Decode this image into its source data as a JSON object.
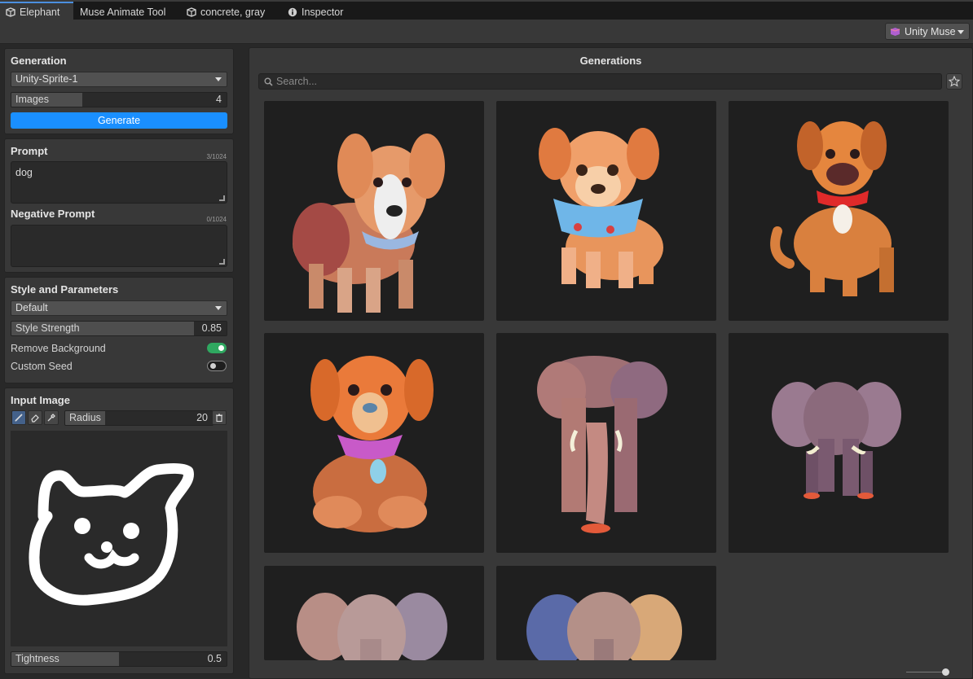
{
  "tabs": [
    {
      "label": "Elephant",
      "icon": "unity-logo-icon",
      "active": true
    },
    {
      "label": "Muse Animate Tool",
      "icon": "",
      "active": false
    },
    {
      "label": "concrete, gray",
      "icon": "unity-logo-icon",
      "active": false
    },
    {
      "label": "Inspector",
      "icon": "info-icon",
      "active": false
    }
  ],
  "toolbar": {
    "muse_label": "Unity Muse",
    "muse_icon": "muse-logo-icon"
  },
  "generation": {
    "title": "Generation",
    "model": "Unity-Sprite-1",
    "images_label": "Images",
    "images_value": "4",
    "images_fill": 0.33,
    "generate_label": "Generate"
  },
  "prompt": {
    "title": "Prompt",
    "count": "3/1024",
    "value": "dog",
    "negative_title": "Negative Prompt",
    "negative_count": "0/1024",
    "negative_value": ""
  },
  "style": {
    "title": "Style and Parameters",
    "preset": "Default",
    "strength_label": "Style Strength",
    "strength_value": "0.85",
    "strength_fill": 0.85,
    "remove_bg_label": "Remove Background",
    "remove_bg_on": true,
    "custom_seed_label": "Custom Seed",
    "custom_seed_on": false
  },
  "input_image": {
    "title": "Input Image",
    "tools": [
      "brush-icon",
      "eraser-icon",
      "eyedropper-icon"
    ],
    "radius_label": "Radius",
    "radius_value": "20",
    "radius_fill": 0.27,
    "tightness_label": "Tightness",
    "tightness_value": "0.5",
    "tightness_fill": 0.5
  },
  "generations": {
    "title": "Generations",
    "search_placeholder": "Search...",
    "items": [
      "dog",
      "dog",
      "dog",
      "dog",
      "elephant",
      "elephant",
      "elephant",
      "elephant"
    ]
  },
  "colors": {
    "accent": "#1a8fff",
    "toggle_on": "#2fa860",
    "panel": "#383838",
    "background": "#282828"
  }
}
